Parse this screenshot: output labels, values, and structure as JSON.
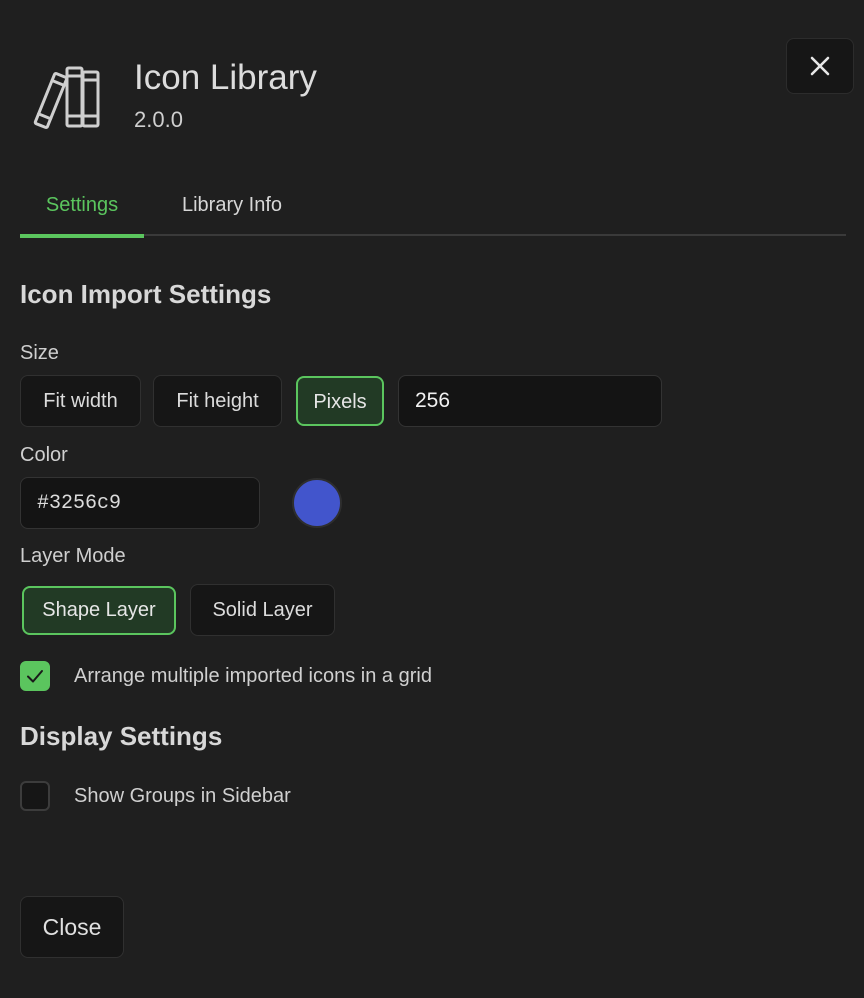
{
  "header": {
    "logo_icon": "books-icon",
    "title": "Icon Library",
    "version": "2.0.0",
    "close_icon": "close-icon"
  },
  "tabs": [
    {
      "label": "Settings",
      "active": true
    },
    {
      "label": "Library Info",
      "active": false
    }
  ],
  "import_settings": {
    "title": "Icon Import Settings",
    "size": {
      "label": "Size",
      "options": [
        {
          "label": "Fit width",
          "active": false
        },
        {
          "label": "Fit height",
          "active": false
        },
        {
          "label": "Pixels",
          "active": true
        }
      ],
      "pixels_value": "256"
    },
    "color": {
      "label": "Color",
      "value": "#3256c9",
      "swatch_color": "#4255cc"
    },
    "layer_mode": {
      "label": "Layer Mode",
      "options": [
        {
          "label": "Shape Layer",
          "active": true
        },
        {
          "label": "Solid Layer",
          "active": false
        }
      ]
    },
    "grid_option": {
      "label": "Arrange multiple imported icons in a grid",
      "checked": true
    }
  },
  "display_settings": {
    "title": "Display Settings",
    "show_groups": {
      "label": "Show Groups in Sidebar",
      "checked": false
    }
  },
  "footer": {
    "close_label": "Close"
  },
  "colors": {
    "accent": "#5bc55e",
    "background": "#1f1f1f"
  }
}
